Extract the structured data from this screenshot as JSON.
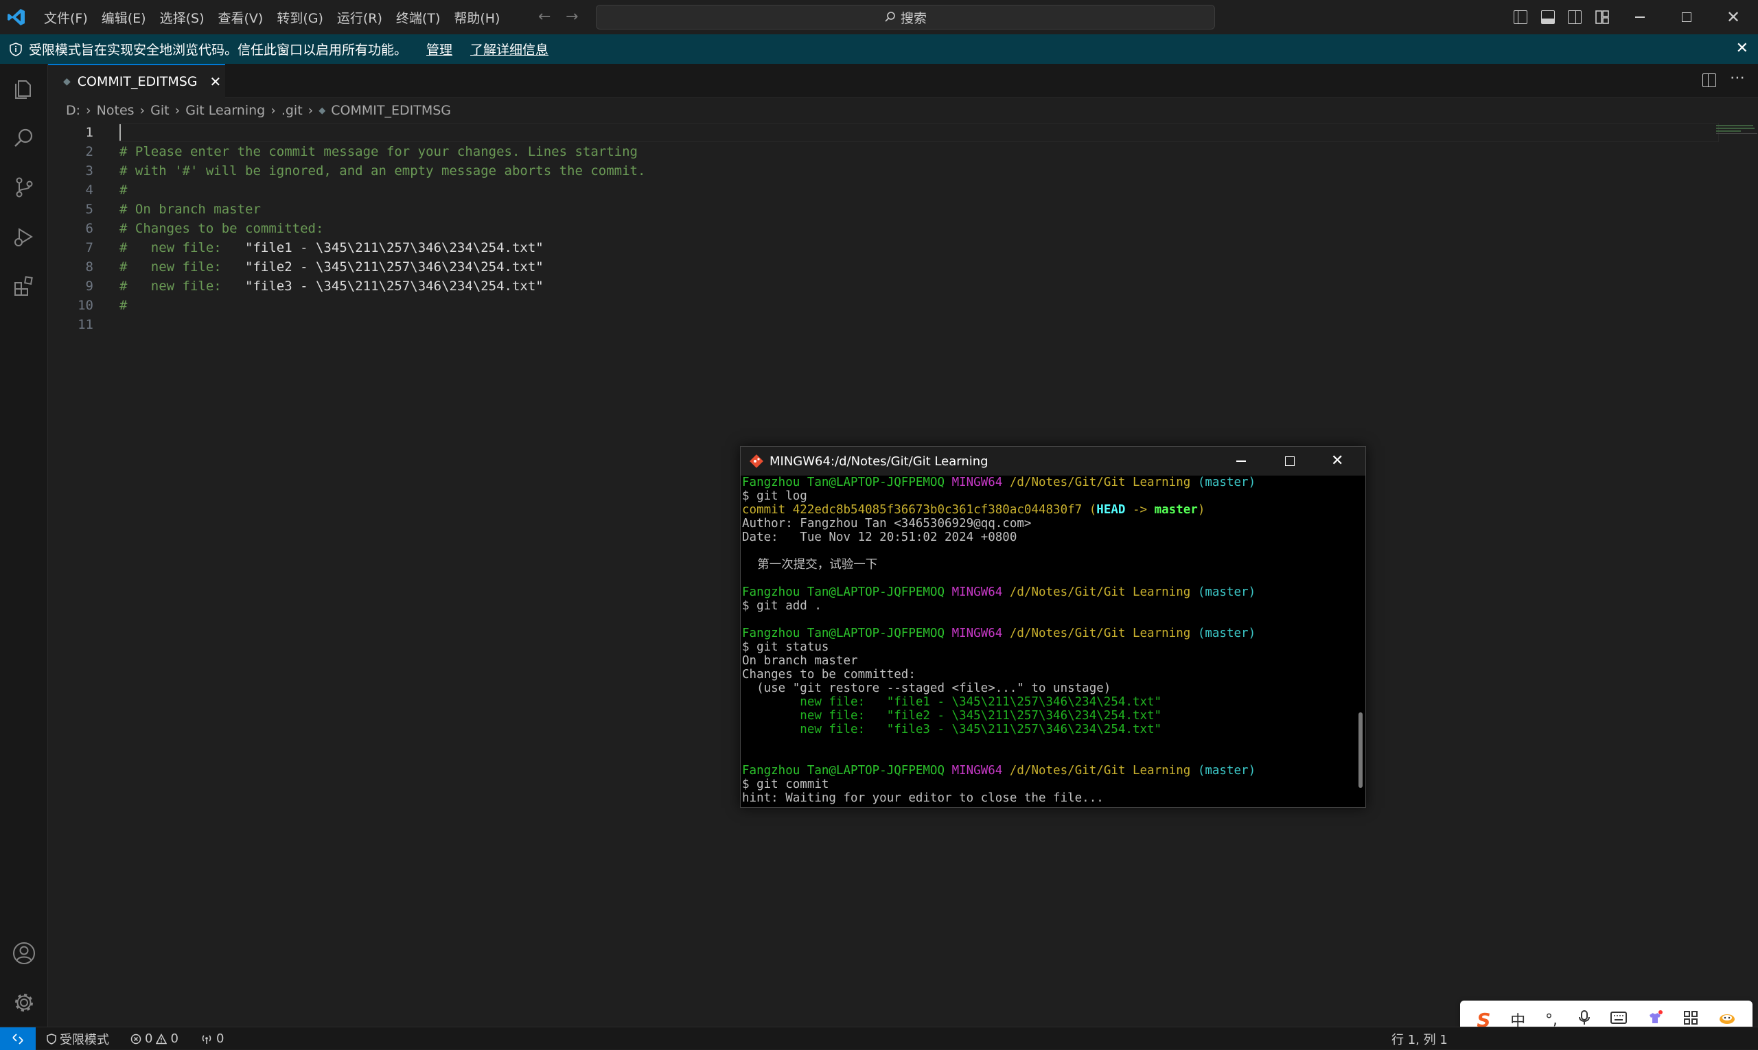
{
  "menu": [
    "文件(F)",
    "编辑(E)",
    "选择(S)",
    "查看(V)",
    "转到(G)",
    "运行(R)",
    "终端(T)",
    "帮助(H)"
  ],
  "search": {
    "label": "搜索"
  },
  "banner": {
    "text": "受限模式旨在实现安全地浏览代码。信任此窗口以启用所有功能。",
    "manage": "管理",
    "learn_more": "了解详细信息"
  },
  "tab": {
    "label": "COMMIT_EDITMSG"
  },
  "breadcrumb": [
    "D:",
    "Notes",
    "Git",
    "Git Learning",
    ".git",
    "COMMIT_EDITMSG"
  ],
  "editor": {
    "lines": [
      "",
      "# Please enter the commit message for your changes. Lines starting",
      "# with '#' will be ignored, and an empty message aborts the commit.",
      "#",
      "# On branch master",
      "# Changes to be committed:",
      "#\tnew file:   \"file1 - \\345\\211\\257\\346\\234\\254.txt\"",
      "#\tnew file:   \"file2 - \\345\\211\\257\\346\\234\\254.txt\"",
      "#\tnew file:   \"file3 - \\345\\211\\257\\346\\234\\254.txt\"",
      "#",
      ""
    ]
  },
  "terminal": {
    "title": "MINGW64:/d/Notes/Git/Git Learning",
    "prompt_user": "Fangzhou Tan@LAPTOP-JQFPEMOQ",
    "prompt_env": "MINGW64",
    "prompt_path": "/d/Notes/Git/Git Learning",
    "prompt_branch": "(master)",
    "cmd1": "$ git log",
    "commit_label": "commit 422edc8b54085f36673b0c361cf380ac044830f7",
    "commit_head": "HEAD",
    "commit_arrow": " -> ",
    "commit_branch": "master",
    "author": "Author: Fangzhou Tan <3465306929@qq.com>",
    "date": "Date:   Tue Nov 12 20:51:02 2024 +0800",
    "message": "    第一次提交，试验一下",
    "cmd2": "$ git add .",
    "cmd3": "$ git status",
    "status1": "On branch master",
    "status2": "Changes to be committed:",
    "status3": "  (use \"git restore --staged <file>...\" to unstage)",
    "files": [
      "        new file:   \"file1 - \\345\\211\\257\\346\\234\\254.txt\"",
      "        new file:   \"file2 - \\345\\211\\257\\346\\234\\254.txt\"",
      "        new file:   \"file3 - \\345\\211\\257\\346\\234\\254.txt\""
    ],
    "cmd4": "$ git commit",
    "hint": "hint: Waiting for your editor to close the file..."
  },
  "ime": {
    "brand": "S",
    "lang": "中",
    "punct": "°,"
  },
  "status": {
    "restricted": "受限模式",
    "errors": "0",
    "warnings": "0",
    "ports": "0",
    "position": "行 1, 列 1"
  }
}
